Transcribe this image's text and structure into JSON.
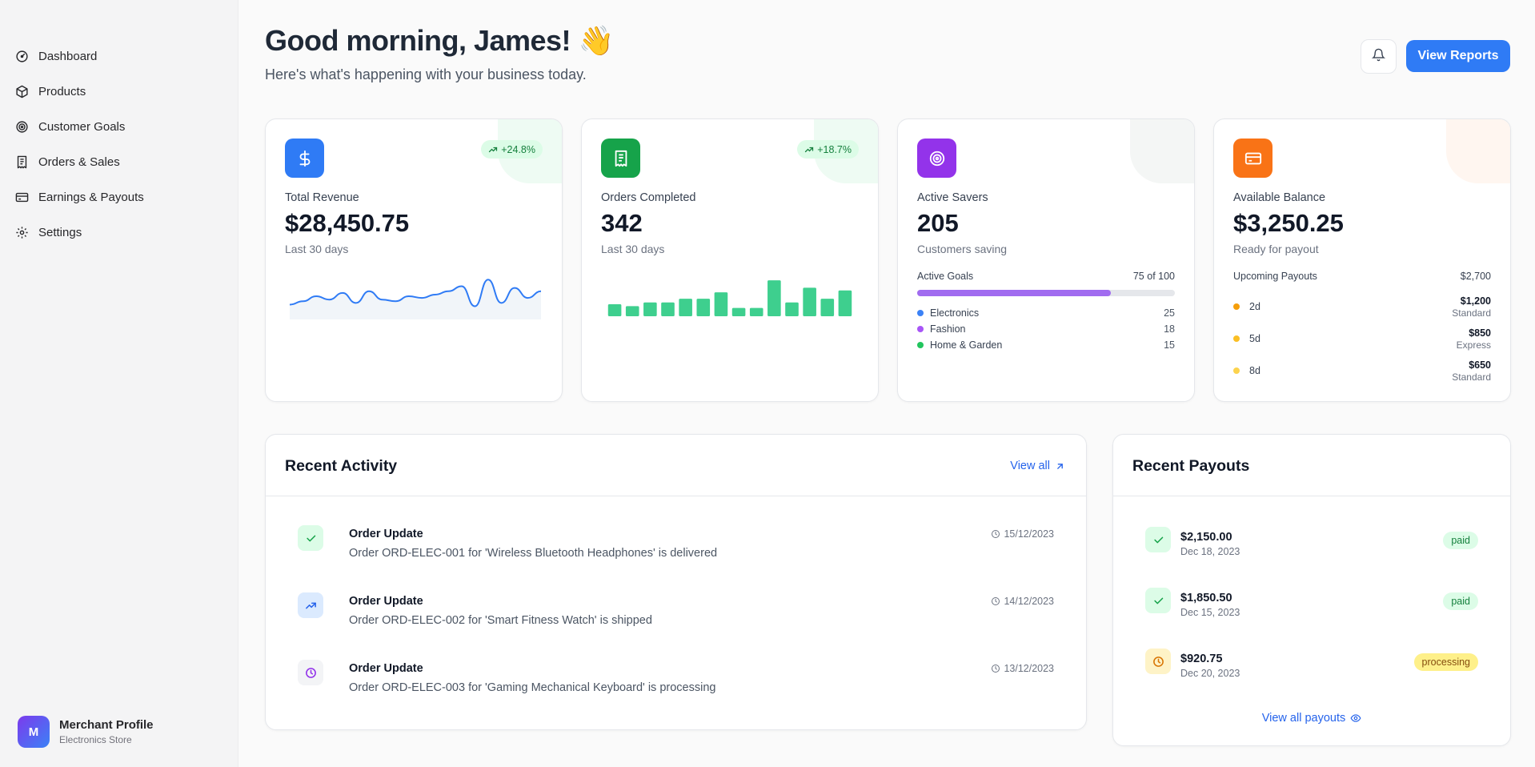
{
  "sidebar": {
    "items": [
      {
        "label": "Dashboard",
        "icon": "gauge-icon"
      },
      {
        "label": "Products",
        "icon": "box-icon"
      },
      {
        "label": "Customer Goals",
        "icon": "target-icon"
      },
      {
        "label": "Orders & Sales",
        "icon": "receipt-icon"
      },
      {
        "label": "Earnings & Payouts",
        "icon": "credit-card-icon"
      },
      {
        "label": "Settings",
        "icon": "gear-icon"
      }
    ],
    "profile": {
      "initial": "M",
      "name": "Merchant Profile",
      "subtitle": "Electronics Store"
    }
  },
  "header": {
    "greeting": "Good morning, James! 👋",
    "subtitle": "Here's what's happening with your business today.",
    "reports_label": "View Reports"
  },
  "stats": {
    "revenue": {
      "label": "Total Revenue",
      "value": "$28,450.75",
      "sub": "Last 30 days",
      "trend": "+24.8%",
      "color": "#2f7bf5"
    },
    "orders": {
      "label": "Orders Completed",
      "value": "342",
      "sub": "Last 30 days",
      "trend": "+18.7%",
      "color": "#16a34a"
    },
    "savers": {
      "label": "Active Savers",
      "value": "205",
      "sub": "Customers saving",
      "color": "#9333ea",
      "goals_label": "Active Goals",
      "goals_count": "75 of 100",
      "goals_fraction": 0.75,
      "categories": [
        {
          "name": "Electronics",
          "count": "25",
          "color": "#3b82f6"
        },
        {
          "name": "Fashion",
          "count": "18",
          "color": "#a855f7"
        },
        {
          "name": "Home & Garden",
          "count": "15",
          "color": "#22c55e"
        }
      ]
    },
    "balance": {
      "label": "Available Balance",
      "value": "$3,250.25",
      "sub": "Ready for payout",
      "color": "#f97316",
      "upcoming_label": "Upcoming Payouts",
      "upcoming_total": "$2,700",
      "upcoming": [
        {
          "days": "2d",
          "amount": "$1,200",
          "type": "Standard",
          "color": "#f59e0b"
        },
        {
          "days": "5d",
          "amount": "$850",
          "type": "Express",
          "color": "#fbbf24"
        },
        {
          "days": "8d",
          "amount": "$650",
          "type": "Standard",
          "color": "#fcd34d"
        }
      ]
    }
  },
  "chart_data": [
    {
      "type": "line",
      "values": [
        14,
        18,
        24,
        20,
        28,
        16,
        30,
        20,
        18,
        24,
        22,
        26,
        30,
        36,
        12,
        44,
        16,
        34,
        22,
        30
      ]
    },
    {
      "type": "bar",
      "values": [
        13,
        11,
        15,
        15,
        19,
        19,
        26,
        9,
        9,
        39,
        15,
        31,
        19,
        28
      ]
    }
  ],
  "activity": {
    "title": "Recent Activity",
    "view_all": "View all",
    "items": [
      {
        "title": "Order Update",
        "desc": "Order ORD-ELEC-001 for 'Wireless Bluetooth Headphones' is delivered",
        "date": "15/12/2023",
        "status": "delivered"
      },
      {
        "title": "Order Update",
        "desc": "Order ORD-ELEC-002 for 'Smart Fitness Watch' is shipped",
        "date": "14/12/2023",
        "status": "shipped"
      },
      {
        "title": "Order Update",
        "desc": "Order ORD-ELEC-003 for 'Gaming Mechanical Keyboard' is processing",
        "date": "13/12/2023",
        "status": "processing"
      }
    ]
  },
  "payouts": {
    "title": "Recent Payouts",
    "view_all": "View all payouts",
    "items": [
      {
        "amount": "$2,150.00",
        "date": "Dec 18, 2023",
        "status": "paid"
      },
      {
        "amount": "$1,850.50",
        "date": "Dec 15, 2023",
        "status": "paid"
      },
      {
        "amount": "$920.75",
        "date": "Dec 20, 2023",
        "status": "processing"
      }
    ]
  }
}
